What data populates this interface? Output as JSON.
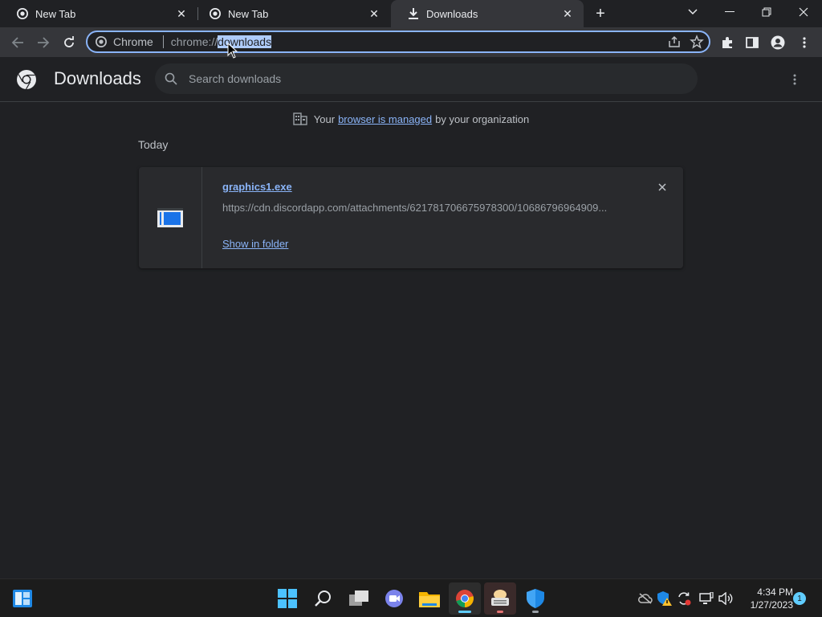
{
  "tabs": [
    {
      "label": "New Tab",
      "icon": "chrome-icon"
    },
    {
      "label": "New Tab",
      "icon": "chrome-icon"
    },
    {
      "label": "Downloads",
      "icon": "download-icon",
      "active": true
    }
  ],
  "omnibox": {
    "chip_label": "Chrome",
    "scheme": "chrome://",
    "path": "downloads"
  },
  "header": {
    "title": "Downloads",
    "search_placeholder": "Search downloads"
  },
  "managed_notice": {
    "prefix": "Your",
    "link": "browser is managed",
    "suffix": "by your organization"
  },
  "group_label": "Today",
  "downloads": [
    {
      "file_name": "graphics1.exe",
      "url": "https://cdn.discordapp.com/attachments/621781706675978300/10686796964909...",
      "action": "Show in folder"
    }
  ],
  "taskbar": {
    "time": "4:34 PM",
    "date": "1/27/2023",
    "notification_count": "1"
  },
  "colors": {
    "accent": "#8ab4f8",
    "background": "#202124",
    "toolbar": "#35363a",
    "taskbar": "#1c1c1c"
  }
}
